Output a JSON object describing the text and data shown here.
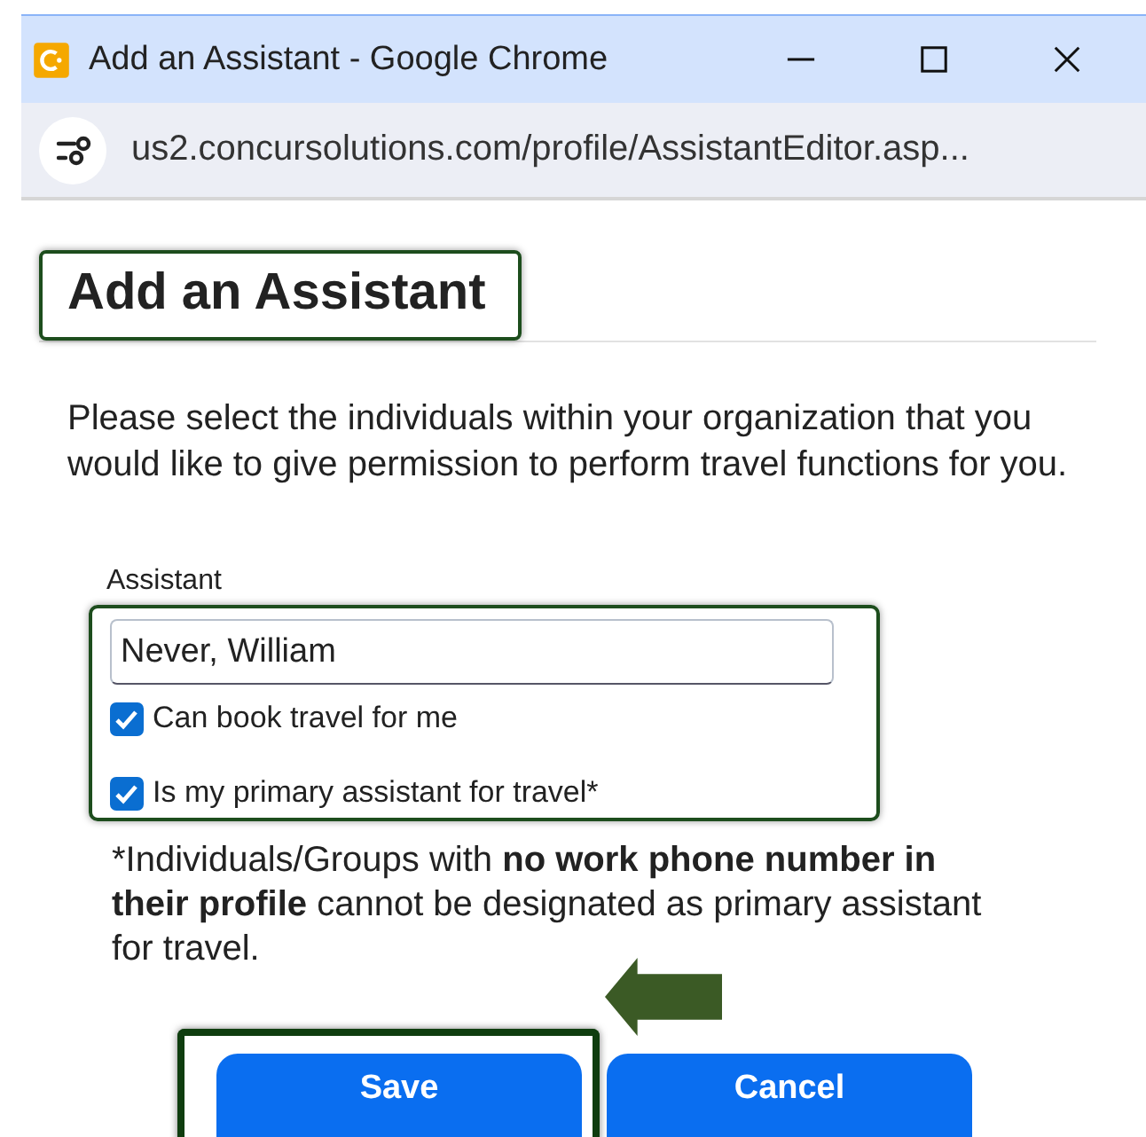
{
  "window": {
    "title": "Add an Assistant - Google Chrome",
    "url": "us2.concursolutions.com/profile/AssistantEditor.asp..."
  },
  "heading": {
    "text": "Add an Assistant",
    "highlighted": true
  },
  "intro": "Please select the individuals within your organization that you would like to give permission to perform travel functions for you.",
  "assistant": {
    "label": "Assistant",
    "value": "Never, William",
    "highlighted": true,
    "options": [
      {
        "label": "Can book travel for me",
        "checked": true
      },
      {
        "label": "Is my primary assistant for travel*",
        "checked": true
      }
    ]
  },
  "footnote": "*Individuals/Groups with **no work phone number in their profile** cannot be designated as primary assistant for travel.",
  "buttons": [
    {
      "label": "Save",
      "highlighted": true
    },
    {
      "label": "Cancel",
      "highlighted": false
    }
  ]
}
